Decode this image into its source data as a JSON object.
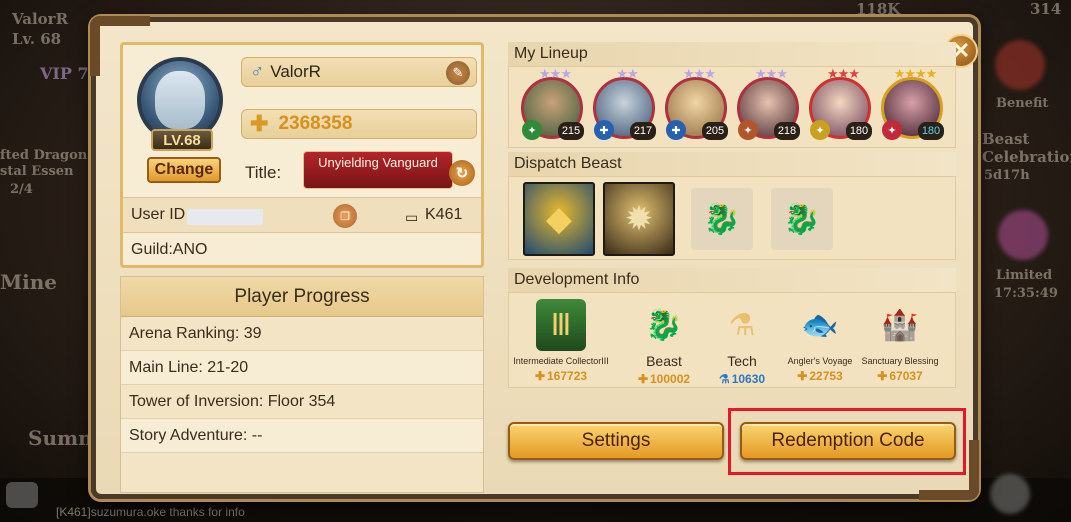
{
  "background": {
    "player_name": "ValorR",
    "player_level": "Lv. 68",
    "vip": "VIP 7",
    "gold": "118K",
    "gems": "314",
    "event_left_1": "fted Dragon",
    "event_left_2": "stal Essen",
    "event_left_3": "2/4",
    "mine": "Mine",
    "summ": "Summ",
    "benefit": "Benefit",
    "beast_celebration": "Beast Celebration",
    "beast_timer": "5d17h",
    "limited": "Limited",
    "limited_timer": "17:35:49",
    "chat_line": "[K461]suzumura.oke thanks for info"
  },
  "profile": {
    "level": "LV.68",
    "change_label": "Change",
    "name": "ValorR",
    "gender_symbol": "♂",
    "power": "2368358",
    "title_label": "Title:",
    "title_value": "Unyielding Vanguard",
    "user_id_label": "User ID",
    "server": "K461",
    "guild": "Guild:ANO"
  },
  "progress": {
    "header": "Player Progress",
    "rows": [
      "Arena Ranking: 39",
      "Main Line: 21-20",
      "Tower of Inversion: Floor 354",
      "Story Adventure: --"
    ]
  },
  "lineup": {
    "header": "My Lineup",
    "heroes": [
      {
        "level": "215",
        "ring": "#7a58b8",
        "class_color": "#2f8a3a",
        "class_icon": "✦"
      },
      {
        "level": "217",
        "ring": "#7a58b8",
        "class_color": "#2660b0",
        "class_icon": "✚"
      },
      {
        "level": "205",
        "ring": "#7a58b8",
        "class_color": "#2660b0",
        "class_icon": "✚"
      },
      {
        "level": "218",
        "ring": "#7a58b8",
        "class_color": "#b0562a",
        "class_icon": "✦"
      },
      {
        "level": "180",
        "ring": "#d03030",
        "class_color": "#c9a020",
        "class_icon": "✦"
      },
      {
        "level": "180",
        "ring": "#d8a020",
        "class_color": "#c02a3a",
        "class_icon": "✦"
      }
    ]
  },
  "dispatch": {
    "header": "Dispatch Beast"
  },
  "development": {
    "header": "Development Info",
    "items": [
      {
        "label": "Intermediate CollectorIII",
        "value": "167723",
        "icon": "Ⅲ"
      },
      {
        "label": "Beast",
        "value": "100002",
        "icon": "🐉"
      },
      {
        "label": "Tech",
        "value": "10630",
        "icon": "⚗"
      },
      {
        "label": "Angler's Voyage",
        "value": "22753",
        "icon": "🐟"
      },
      {
        "label": "Sanctuary Blessing",
        "value": "67037",
        "icon": "🏰"
      }
    ]
  },
  "buttons": {
    "settings": "Settings",
    "redemption": "Redemption Code"
  },
  "colors": {
    "panel_bg": "#f3e6c9",
    "accent_gold": "#e39a22",
    "highlight": "#e3182a",
    "power_text": "#d9901c"
  }
}
